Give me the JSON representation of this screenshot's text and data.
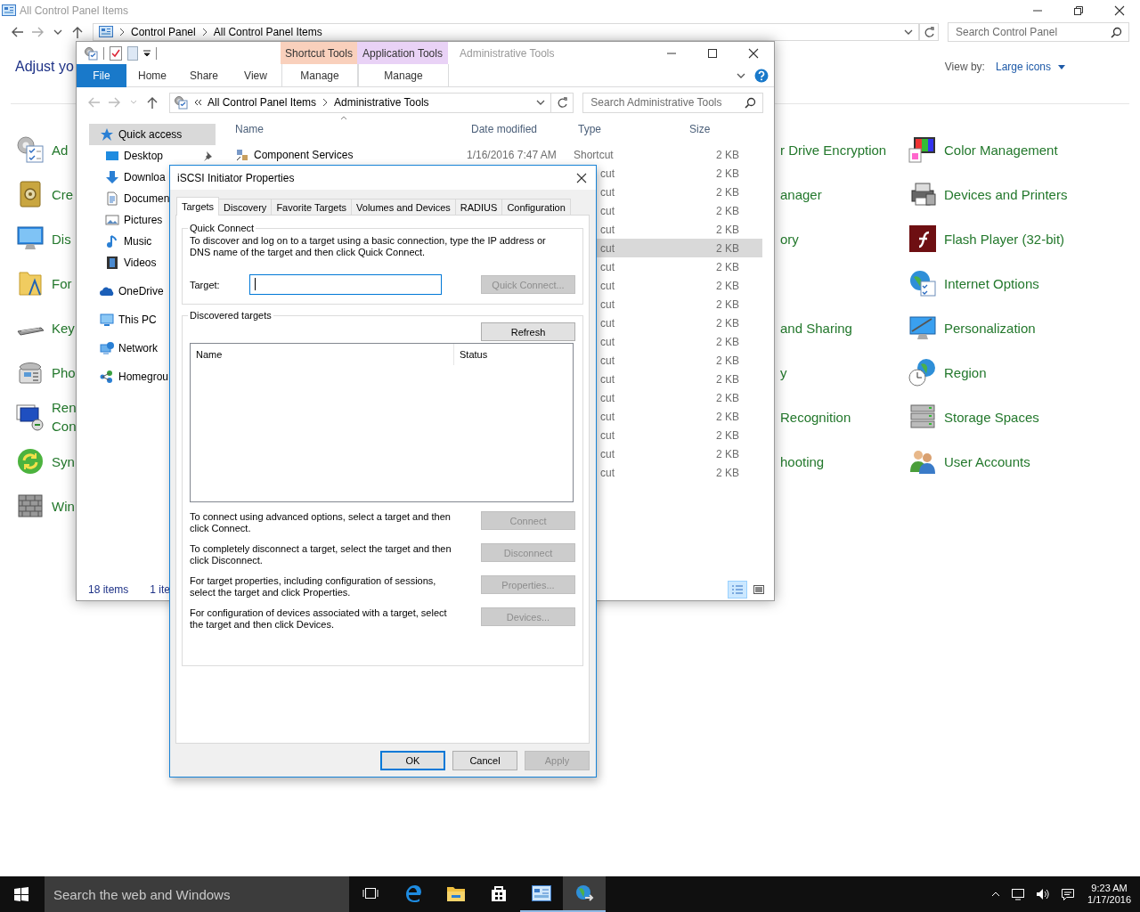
{
  "control_panel": {
    "title": "All Control Panel Items",
    "breadcrumb": [
      "Control Panel",
      "All Control Panel Items"
    ],
    "search_placeholder": "Search Control Panel",
    "heading": "Adjust yo",
    "view_by_label": "View by:",
    "view_by_value": "Large icons",
    "rows": [
      {
        "left": "Ad",
        "middle": "r Drive Encryption",
        "right": "Color Management"
      },
      {
        "left": "Cre",
        "middle": "anager",
        "right": "Devices and Printers"
      },
      {
        "left": "Dis",
        "middle": "ory",
        "right": "Flash Player (32-bit)"
      },
      {
        "left": "For",
        "right": "Internet Options"
      },
      {
        "left": "Key",
        "middle": "and Sharing",
        "right": "Personalization"
      },
      {
        "left": "Pho",
        "middle": "y",
        "right": "Region"
      },
      {
        "left": "Ren\nCon",
        "middle": "Recognition",
        "right": "Storage Spaces"
      },
      {
        "left": "Syn",
        "middle": "hooting",
        "right": "User Accounts"
      },
      {
        "left": "Win"
      }
    ]
  },
  "explorer": {
    "title": "Administrative Tools",
    "context_tabs": [
      {
        "group": "Shortcut Tools",
        "tab": "Manage",
        "color": "#f9d0bc"
      },
      {
        "group": "Application Tools",
        "tab": "Manage",
        "color": "#e9d2f6"
      }
    ],
    "ribbon_tabs": [
      {
        "label": "File",
        "kind": "file"
      },
      {
        "label": "Home",
        "kind": "tab"
      },
      {
        "label": "Share",
        "kind": "tab"
      },
      {
        "label": "View",
        "kind": "tab"
      }
    ],
    "address": [
      "All Control Panel Items",
      "Administrative Tools"
    ],
    "search_placeholder": "Search Administrative Tools",
    "nav": [
      {
        "label": "Quick access",
        "selected": true,
        "children": [
          {
            "label": "Desktop",
            "pinned": true
          },
          {
            "label": "Downloa"
          },
          {
            "label": "Documen"
          },
          {
            "label": "Pictures"
          },
          {
            "label": "Music"
          },
          {
            "label": "Videos"
          }
        ]
      },
      {
        "label": "OneDrive",
        "selected": false
      },
      {
        "label": "This PC",
        "selected": false
      },
      {
        "label": "Network",
        "selected": false
      },
      {
        "label": "Homegrou",
        "selected": false
      }
    ],
    "columns": [
      "Name",
      "Date modified",
      "Type",
      "Size"
    ],
    "files": [
      {
        "name": "Component Services",
        "date": "1/16/2016 7:47 AM",
        "type": "Shortcut",
        "size": "2 KB",
        "selected": false
      },
      {
        "type": "cut",
        "size": "2 KB",
        "selected": false
      },
      {
        "type": "cut",
        "size": "2 KB",
        "selected": false
      },
      {
        "type": "cut",
        "size": "2 KB",
        "selected": false
      },
      {
        "type": "cut",
        "size": "2 KB",
        "selected": false
      },
      {
        "type": "cut",
        "size": "2 KB",
        "selected": true
      },
      {
        "type": "cut",
        "size": "2 KB",
        "selected": false
      },
      {
        "type": "cut",
        "size": "2 KB",
        "selected": false
      },
      {
        "type": "cut",
        "size": "2 KB",
        "selected": false
      },
      {
        "type": "cut",
        "size": "2 KB",
        "selected": false
      },
      {
        "type": "cut",
        "size": "2 KB",
        "selected": false
      },
      {
        "type": "cut",
        "size": "2 KB",
        "selected": false
      },
      {
        "type": "cut",
        "size": "2 KB",
        "selected": false
      },
      {
        "type": "cut",
        "size": "2 KB",
        "selected": false
      },
      {
        "type": "cut",
        "size": "2 KB",
        "selected": false
      },
      {
        "type": "cut",
        "size": "2 KB",
        "selected": false
      },
      {
        "type": "cut",
        "size": "2 KB",
        "selected": false
      },
      {
        "type": "cut",
        "size": "2 KB",
        "selected": false
      }
    ],
    "status": [
      "18 items",
      "1 ite"
    ],
    "views": [
      {
        "selected": true
      },
      {
        "selected": false
      }
    ]
  },
  "dialog": {
    "title": "iSCSI Initiator Properties",
    "tabs": [
      {
        "label": "Targets",
        "selected": true
      },
      {
        "label": "Discovery",
        "selected": false
      },
      {
        "label": "Favorite Targets",
        "selected": false
      },
      {
        "label": "Volumes and Devices",
        "selected": false
      },
      {
        "label": "RADIUS",
        "selected": false
      },
      {
        "label": "Configuration",
        "selected": false
      }
    ],
    "quick_connect": {
      "legend": "Quick Connect",
      "text": "To discover and log on to a target using a basic connection, type the IP address or DNS name of the target and then click Quick Connect.",
      "target_label": "Target:",
      "button": {
        "label": "Quick Connect...",
        "disabled": true
      }
    },
    "discovered": {
      "legend": "Discovered targets",
      "refresh": {
        "label": "Refresh",
        "disabled": false
      },
      "columns": [
        "Name",
        "Status"
      ],
      "actions": [
        {
          "text": "To connect using advanced options, select a target and then click Connect.",
          "button": {
            "label": "Connect",
            "disabled": true
          }
        },
        {
          "text": "To completely disconnect a target, select the target and then click Disconnect.",
          "button": {
            "label": "Disconnect",
            "disabled": true
          }
        },
        {
          "text": "For target properties, including configuration of sessions, select the target and click Properties.",
          "button": {
            "label": "Properties...",
            "disabled": true
          }
        },
        {
          "text": "For configuration of devices associated with a target, select the target and then click Devices.",
          "button": {
            "label": "Devices...",
            "disabled": true
          }
        }
      ]
    },
    "buttons": [
      {
        "label": "OK",
        "disabled": false,
        "default": true
      },
      {
        "label": "Cancel",
        "disabled": false,
        "default": false
      },
      {
        "label": "Apply",
        "disabled": true,
        "default": false
      }
    ]
  },
  "taskbar": {
    "search_placeholder": "Search the web and Windows",
    "apps": [
      {
        "open": false,
        "active": false
      },
      {
        "open": false,
        "active": false
      },
      {
        "open": false,
        "active": false
      },
      {
        "open": true,
        "active": false
      },
      {
        "open": true,
        "active": true
      }
    ],
    "time": "9:23 AM",
    "date": "1/17/2016"
  }
}
